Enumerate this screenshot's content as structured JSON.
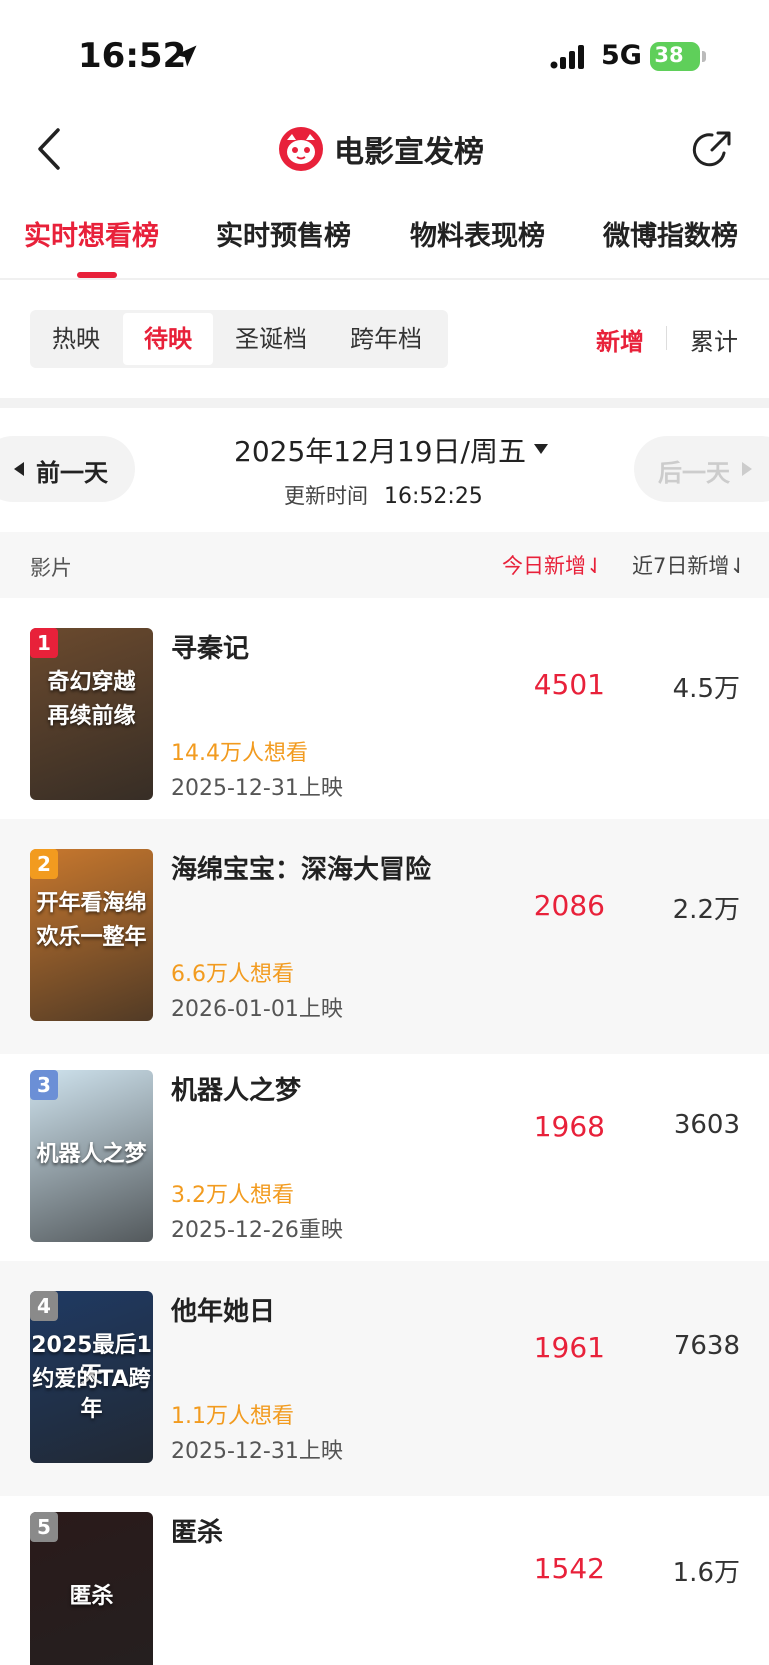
{
  "status": {
    "time": "16:52",
    "network": "5G",
    "battery": "38"
  },
  "nav": {
    "title": "电影宣发榜"
  },
  "tabs": [
    {
      "label": "实时想看榜",
      "active": true
    },
    {
      "label": "实时预售榜",
      "active": false
    },
    {
      "label": "物料表现榜",
      "active": false
    },
    {
      "label": "微博指数榜",
      "active": false
    }
  ],
  "segments": [
    {
      "label": "热映",
      "active": false
    },
    {
      "label": "待映",
      "active": true
    },
    {
      "label": "圣诞档",
      "active": false
    },
    {
      "label": "跨年档",
      "active": false
    }
  ],
  "mode": {
    "new_label": "新增",
    "total_label": "累计"
  },
  "date_nav": {
    "prev_label": "前一天",
    "date": "2025年12月19日/周五",
    "update_label": "更新时间",
    "update_time": "16:52:25",
    "next_label": "后一天"
  },
  "table_header": {
    "film": "影片",
    "today": "今日新增⇃",
    "week": "近7日新增⇃"
  },
  "films": [
    {
      "rank": "1",
      "name": "寻秦记",
      "want": "14.4万人想看",
      "release": "2025-12-31上映",
      "today": "4501",
      "week": "4.5万",
      "poster_text": [
        "奇幻穿越",
        "再续前缘"
      ],
      "badge_color": "#e8213a",
      "poster_bg": "#6b4a2e"
    },
    {
      "rank": "2",
      "name": "海绵宝宝：深海大冒险",
      "want": "6.6万人想看",
      "release": "2026-01-01上映",
      "today": "2086",
      "week": "2.2万",
      "poster_text": [
        "开年看海绵",
        "欢乐一整年"
      ],
      "badge_color": "#f29b1f",
      "poster_bg": "#c8782e"
    },
    {
      "rank": "3",
      "name": "机器人之梦",
      "want": "3.2万人想看",
      "release": "2025-12-26重映",
      "today": "1968",
      "week": "3603",
      "poster_text": [
        "机器人之梦"
      ],
      "badge_color": "#6b8fd6",
      "poster_bg": "#cfe3ee"
    },
    {
      "rank": "4",
      "name": "他年她日",
      "want": "1.1万人想看",
      "release": "2025-12-31上映",
      "today": "1961",
      "week": "7638",
      "poster_text": [
        "2025最后1天",
        "约爱的TA跨年"
      ],
      "badge_color": "#8a8a8a",
      "poster_bg": "#1f3a63"
    },
    {
      "rank": "5",
      "name": "匿杀",
      "want": "",
      "release": "",
      "today": "1542",
      "week": "1.6万",
      "poster_text": [
        "匿杀"
      ],
      "badge_color": "#8a8a8a",
      "poster_bg": "#2a1a1a"
    }
  ]
}
